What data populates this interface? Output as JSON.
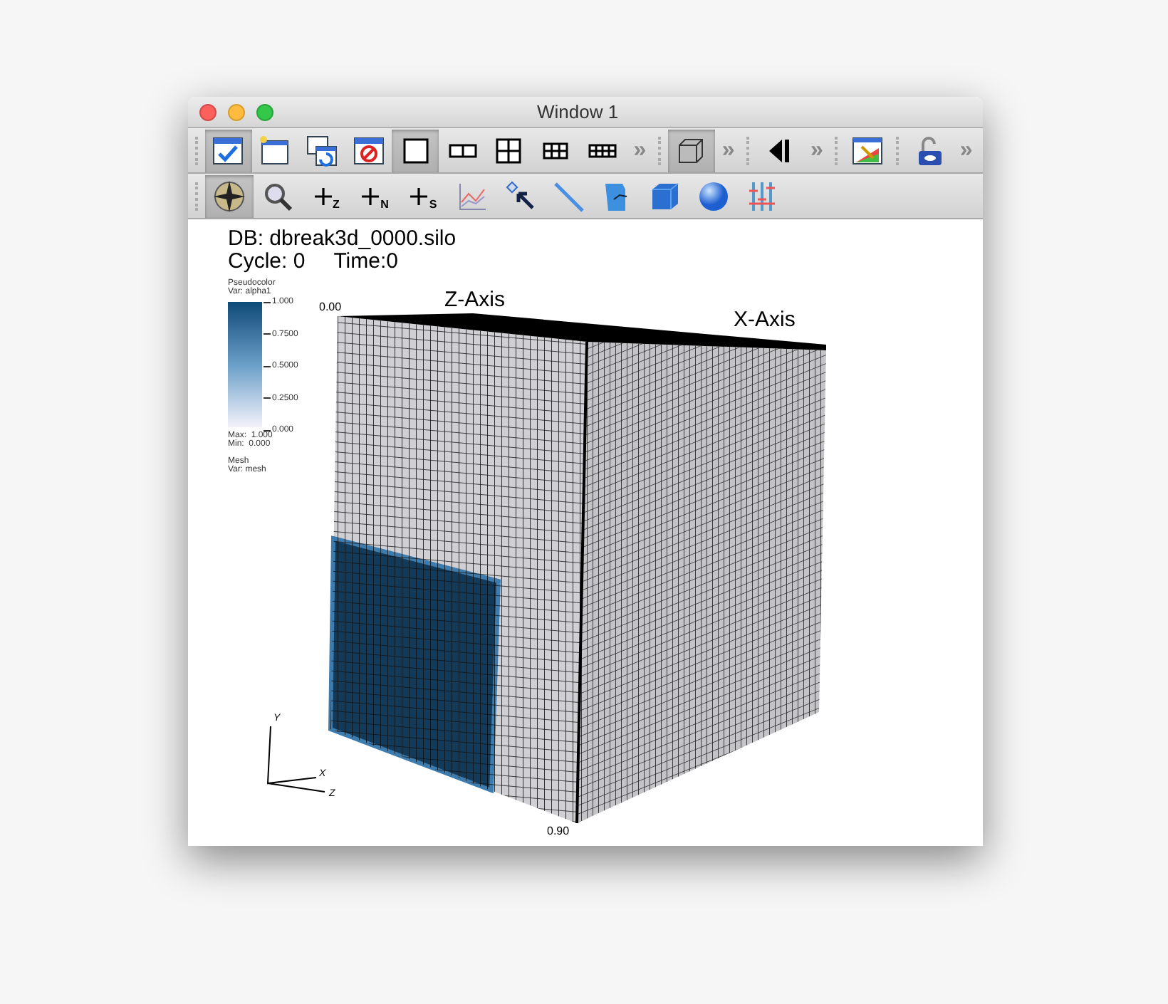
{
  "window": {
    "title": "Window 1"
  },
  "toolbar_1": [
    {
      "kind": "handle"
    },
    {
      "kind": "active-window",
      "selected": true
    },
    {
      "kind": "new-window",
      "selected": false
    },
    {
      "kind": "clone-window",
      "selected": false
    },
    {
      "kind": "delete-window",
      "selected": false
    },
    {
      "kind": "layout-1",
      "selected": true
    },
    {
      "kind": "layout-2",
      "selected": false
    },
    {
      "kind": "layout-4",
      "selected": false
    },
    {
      "kind": "layout-6",
      "selected": false
    },
    {
      "kind": "layout-8",
      "selected": false
    },
    {
      "kind": "more",
      "text": "»"
    },
    {
      "kind": "handle"
    },
    {
      "kind": "perspective",
      "selected": true
    },
    {
      "kind": "more",
      "text": "»"
    },
    {
      "kind": "handle"
    },
    {
      "kind": "step-back",
      "selected": false
    },
    {
      "kind": "more",
      "text": "»"
    },
    {
      "kind": "handle"
    },
    {
      "kind": "annotation",
      "selected": false
    },
    {
      "kind": "handle"
    },
    {
      "kind": "lock",
      "selected": false
    },
    {
      "kind": "more",
      "text": "»"
    }
  ],
  "toolbar_2": [
    {
      "kind": "handle"
    },
    {
      "kind": "navigate",
      "selected": true
    },
    {
      "kind": "zoom",
      "selected": false
    },
    {
      "kind": "pick",
      "sub": "Z",
      "selected": false
    },
    {
      "kind": "pick",
      "sub": "N",
      "selected": false
    },
    {
      "kind": "pick",
      "sub": "S",
      "selected": false
    },
    {
      "kind": "curve",
      "selected": false
    },
    {
      "kind": "point",
      "selected": false
    },
    {
      "kind": "line",
      "selected": false
    },
    {
      "kind": "plane",
      "selected": false
    },
    {
      "kind": "box",
      "selected": false
    },
    {
      "kind": "sphere",
      "selected": false
    },
    {
      "kind": "axis-array",
      "selected": false
    }
  ],
  "plot": {
    "db": "DB: dbreak3d_0000.silo",
    "cycle": "Cycle: 0",
    "time": "Time:0",
    "legend": {
      "title": "Pseudocolor",
      "var": "Var: alpha1",
      "ticks": [
        "1.000",
        "0.7500",
        "0.5000",
        "0.2500",
        "0.000"
      ],
      "max": "Max:  1.000",
      "min": "Min:  0.000",
      "mesh_title": "Mesh",
      "mesh_var": "Var: mesh"
    },
    "z_axis": "Z-Axis",
    "x_axis": "X-Axis",
    "top_tick": "0.00",
    "bottom_tick": "0.90",
    "triad": {
      "y": "Y",
      "x": "X",
      "z": "Z"
    }
  }
}
